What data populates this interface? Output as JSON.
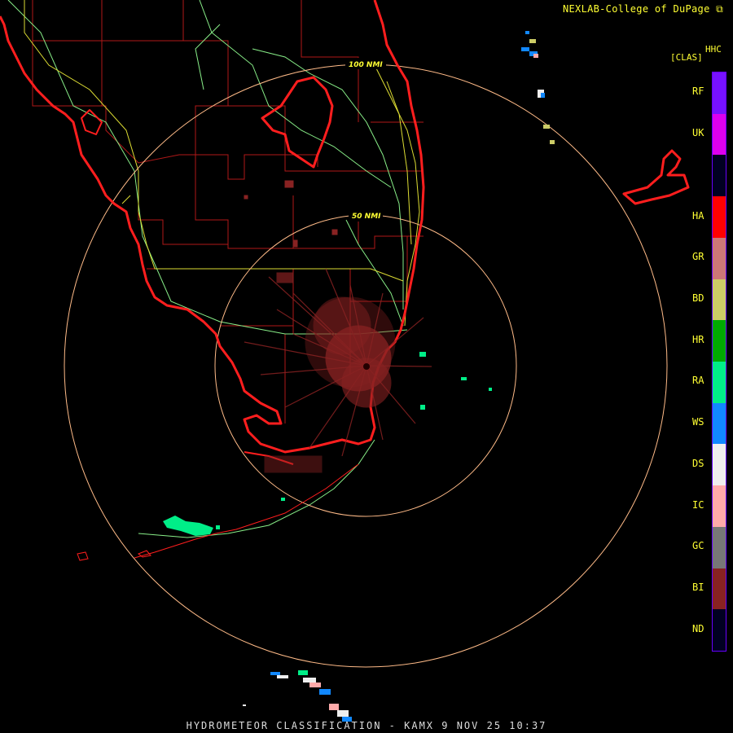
{
  "header": {
    "credit": "NEXLAB-College of DuPage",
    "credit_icon": "external-link-icon"
  },
  "product": {
    "code": "HHC",
    "class_label": "[CLAS]"
  },
  "rings": [
    {
      "label": "100 NMI"
    },
    {
      "label": "50 NMI"
    }
  ],
  "legend": [
    {
      "code": "RF",
      "color": "#7711ff"
    },
    {
      "code": "UK",
      "color": "#dd00ee"
    },
    {
      "code": "",
      "color": "#000022"
    },
    {
      "code": "HA",
      "color": "#ff0000"
    },
    {
      "code": "GR",
      "color": "#cc7777"
    },
    {
      "code": "BD",
      "color": "#cccc66"
    },
    {
      "code": "HR",
      "color": "#00aa00"
    },
    {
      "code": "RA",
      "color": "#00ee88"
    },
    {
      "code": "WS",
      "color": "#1188ff"
    },
    {
      "code": "DS",
      "color": "#eeeeee"
    },
    {
      "code": "IC",
      "color": "#ffaaaa"
    },
    {
      "code": "GC",
      "color": "#777777"
    },
    {
      "code": "BI",
      "color": "#882222"
    },
    {
      "code": "ND",
      "color": "#000022"
    }
  ],
  "footer": "HYDROMETEOR CLASSIFICATION - KAMX 9 NOV 25 10:37",
  "colors": {
    "coast": "#ff2020",
    "county": "#cc2222",
    "highway": "#99ff99",
    "ring": "#ffbb88"
  }
}
